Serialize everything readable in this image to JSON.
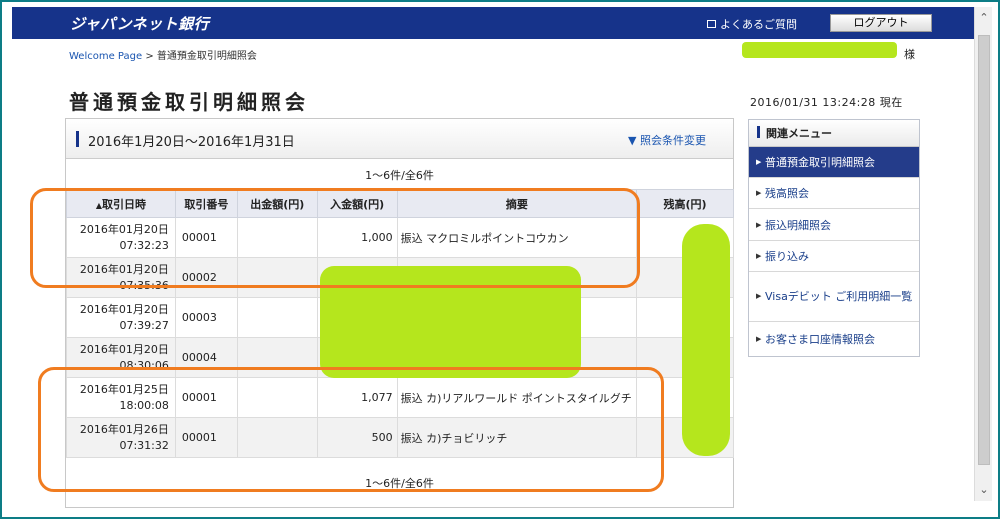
{
  "header": {
    "logo": "ジャパンネット銀行",
    "faq_label": "よくあるご質問",
    "logout_label": "ログアウト"
  },
  "breadcrumb": {
    "home": "Welcome Page",
    "separator": ">",
    "current": "普通預金取引明細照会"
  },
  "user": {
    "suffix": "様"
  },
  "page": {
    "title": "普通預金取引明細照会",
    "datetime": "2016/01/31 13:24:28 現在"
  },
  "panel": {
    "period": "2016年1月20日〜2016年1月31日",
    "cond_change": "照会条件変更",
    "count_top": "1〜6件/全6件",
    "count_bottom": "1〜6件/全6件"
  },
  "table": {
    "headers": {
      "date": "取引日時",
      "txno": "取引番号",
      "out": "出金額(円)",
      "in": "入金額(円)",
      "desc": "摘要",
      "bal": "残高(円)"
    },
    "rows": [
      {
        "date": "2016年01月20日",
        "time": "07:32:23",
        "txno": "00001",
        "out": "",
        "in": "1,000",
        "desc": "振込 マクロミルポイントコウカン"
      },
      {
        "date": "2016年01月20日",
        "time": "07:35:36",
        "txno": "00002",
        "out": "",
        "in": "",
        "desc": ""
      },
      {
        "date": "2016年01月20日",
        "time": "07:39:27",
        "txno": "00003",
        "out": "",
        "in": "",
        "desc": ""
      },
      {
        "date": "2016年01月20日",
        "time": "08:30:06",
        "txno": "00004",
        "out": "",
        "in": "",
        "desc": ""
      },
      {
        "date": "2016年01月25日",
        "time": "18:00:08",
        "txno": "00001",
        "out": "",
        "in": "1,077",
        "desc": "振込 カ)リアルワールド ポイントスタイルグチ"
      },
      {
        "date": "2016年01月26日",
        "time": "07:31:32",
        "txno": "00001",
        "out": "",
        "in": "500",
        "desc": "振込 カ)チョビリッチ"
      }
    ]
  },
  "side_menu": {
    "title": "関連メニュー",
    "items": [
      {
        "label": "普通預金取引明細照会",
        "active": true
      },
      {
        "label": "残高照会"
      },
      {
        "label": "振込明細照会"
      },
      {
        "label": "振り込み"
      },
      {
        "label": "Visaデビット ご利用明細一覧"
      },
      {
        "label": "お客さま口座情報照会"
      }
    ]
  },
  "colors": {
    "header_bg": "#16338a",
    "annotation": "#f07c20",
    "redaction": "#b5e61d",
    "menu_active": "#243c8a"
  }
}
